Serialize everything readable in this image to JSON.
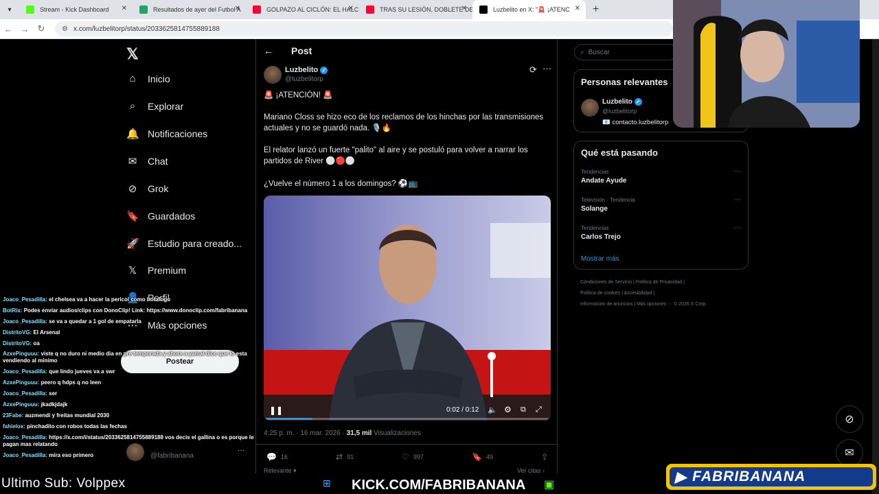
{
  "browser": {
    "tabs": [
      {
        "title": "Stream - Kick Dashboard",
        "color": "#53fc18",
        "active": false
      },
      {
        "title": "Resultados de ayer del Futbol A",
        "color": "#1fa463",
        "active": false
      },
      {
        "title": "GOLPAZO AL CICLÓN: EL HALC",
        "color": "#ff0033",
        "active": false
      },
      {
        "title": "TRAS SU LESIÓN, DOBLETE DE",
        "color": "#ff0033",
        "active": false
      },
      {
        "title": "Luzbelito en X: \"🚨 ¡ATENC",
        "color": "#000000",
        "active": true
      }
    ],
    "url": "x.com/luzbelitorp/status/2033625814755889188"
  },
  "nav": {
    "items": [
      {
        "label": "Inicio",
        "icon": "home-icon"
      },
      {
        "label": "Explorar",
        "icon": "search-icon"
      },
      {
        "label": "Notificaciones",
        "icon": "bell-icon"
      },
      {
        "label": "Chat",
        "icon": "mail-icon"
      },
      {
        "label": "Grok",
        "icon": "grok-icon"
      },
      {
        "label": "Guardados",
        "icon": "bookmark-icon"
      },
      {
        "label": "Estudio para creado...",
        "icon": "rocket-icon"
      },
      {
        "label": "Premium",
        "icon": "x-icon"
      },
      {
        "label": "Perfil",
        "icon": "person-icon"
      },
      {
        "label": "Más opciones",
        "icon": "more-icon"
      }
    ],
    "post_button": "Postear",
    "account_handle": "@fabribanana"
  },
  "post": {
    "header": "Post",
    "author_name": "Luzbelito",
    "author_handle": "@luzbelitorp",
    "text": [
      "🚨 ¡ATENCIÓN! 🚨",
      "Mariano Closs se hizo eco de los reclamos de los hinchas por las transmisiones actuales y no se guardó nada. 🎙️🔥",
      "El relator lanzó un fuerte \"palito\" al aire y se postuló para volver a narrar los partidos de River ⚪🔴⚪",
      "¿Vuelve el número 1 a los domingos? ⚽📺"
    ],
    "video_time": "0:02 / 0:12",
    "video_progress": 0.17,
    "timestamp": "4:25 p. m. · 16 mar. 2026 · ",
    "views_count": "31,5 mil",
    "views_label": " Visualizaciones",
    "replies": "16",
    "reposts": "91",
    "likes": "997",
    "bookmarks": "49",
    "relevant_label": "Relevante",
    "quotes_label": "Ver citas"
  },
  "right": {
    "search_placeholder": "Buscar",
    "relevant_title": "Personas relevantes",
    "relevant_name": "Luzbelito",
    "relevant_handle": "@luzbelitorp",
    "relevant_bio": "📧 contacto.luzbelitorp",
    "trends_title": "Qué está pasando",
    "trends": [
      {
        "category": "Tendencias",
        "name": "Andate Ayude"
      },
      {
        "category": "Televisión · Tendencia",
        "name": "Solange"
      },
      {
        "category": "Tendencias",
        "name": "Carlos Trejo"
      }
    ],
    "show_more": "Mostrar más",
    "footer": [
      "Condiciones de Servicio  |  Política de Privacidad  |",
      "Política de cookies  |  Accesibilidad  |",
      "Información de anuncios  |  Más opciones ···  © 2026 X Corp."
    ]
  },
  "chat": [
    {
      "user": "Joaco_Pesadilla:",
      "msg": "el chelsea va a hacer la pericol como botafogo"
    },
    {
      "user": "BotRix:",
      "msg": "Podes enviar audios/clips con DonoClip! Link: https://www.donoclip.com/fabribanana"
    },
    {
      "user": "Joaco_Pesadilla:",
      "msg": "se va a quedar a 1 gol de empatarla"
    },
    {
      "user": "DistritoVG:",
      "msg": "El Arsenal"
    },
    {
      "user": "DistritoVG:",
      "msg": "oa"
    },
    {
      "user": "AzxePinguuu:",
      "msg": "viste q no duro ni medio dia en pre temporada y ahora a yamal dice que lo esta vendiendo al minimo"
    },
    {
      "user": "Joaco_Pesadilla:",
      "msg": "que lindo jueves va a swr"
    },
    {
      "user": "AzxePinguuu:",
      "msg": "peero q hdps q no leen"
    },
    {
      "user": "Joaco_Pesadilla:",
      "msg": "ser"
    },
    {
      "user": "AzxePinguuu:",
      "msg": "jkadkjdajk"
    },
    {
      "user": "23Fabe:",
      "msg": "auzmendi y freitas mundial 2030"
    },
    {
      "user": "fahielox:",
      "msg": "pinchadito con robos todas las fechas"
    },
    {
      "user": "Joaco_Pesadilla:",
      "msg": "https://x.com/i/status/2033625814755889188 vos decis el gallina o es porque le pagan mas relatando"
    },
    {
      "user": "Joaco_Pesadilla:",
      "msg": "mira eso primero"
    }
  ],
  "overlay": {
    "last_sub": "Ultimo Sub: Volppex",
    "kick_url": "KICK.COM/FABRIBANANA",
    "brand": "FABRIBANANA"
  }
}
